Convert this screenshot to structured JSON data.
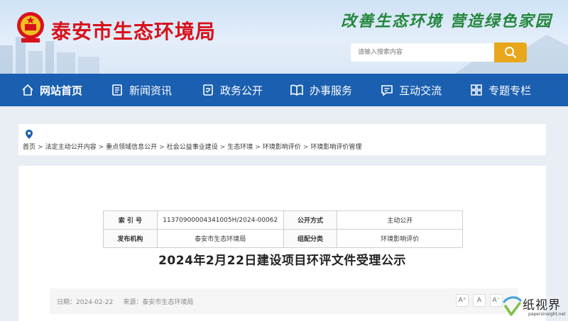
{
  "header": {
    "site_title": "泰安市生态环境局",
    "slogan": "改善生态环境  营造绿色家园",
    "search_placeholder": "请输入搜索内容"
  },
  "nav": {
    "items": [
      {
        "label": "网站首页",
        "icon": "home-icon"
      },
      {
        "label": "新闻资讯",
        "icon": "news-icon"
      },
      {
        "label": "政务公开",
        "icon": "document-icon"
      },
      {
        "label": "办事服务",
        "icon": "book-icon"
      },
      {
        "label": "互动交流",
        "icon": "chat-icon"
      },
      {
        "label": "专题专栏",
        "icon": "grid-icon"
      }
    ]
  },
  "breadcrumb": {
    "items": [
      "首页",
      "法定主动公开内容",
      "重点领域信息公开",
      "社会公益事业建设",
      "生态环境",
      "环境影响评价",
      "环境影响评价管理"
    ],
    "separator": ">"
  },
  "meta": {
    "index_label": "索 引 号",
    "index_value": "11370900004341005H/2024-00062",
    "method_label": "公开方式",
    "method_value": "主动公开",
    "publisher_label": "发布机构",
    "publisher_value": "泰安市生态环境局",
    "category_label": "组配分类",
    "category_value": "环境影响评价"
  },
  "article": {
    "title": "2024年2月22日建设项目环评文件受理公示",
    "date_label": "日期：",
    "date_value": "2024-02-22",
    "source_label": "来源：",
    "source_value": "泰安市生态环境局",
    "font_buttons": [
      "A⁺",
      "A",
      "A⁻"
    ]
  },
  "watermark": {
    "cn": "纸视界",
    "en": "papersinsight.net"
  },
  "colors": {
    "nav_bg": "#1a5fb0",
    "title_red": "#d8121c",
    "slogan_green": "#24873d",
    "search_btn": "#e8a61a"
  }
}
